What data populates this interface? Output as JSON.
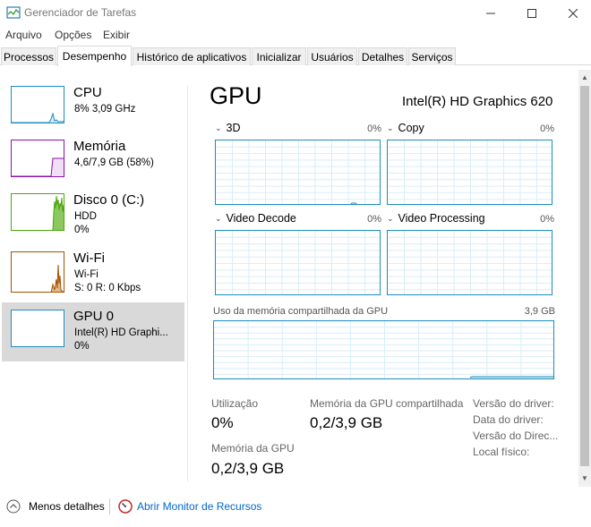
{
  "window": {
    "title": "Gerenciador de Tarefas"
  },
  "menu": [
    "Arquivo",
    "Opções",
    "Exibir"
  ],
  "tabs": [
    "Processos",
    "Desempenho",
    "Histórico de aplicativos",
    "Inicializar",
    "Usuários",
    "Detalhes",
    "Serviços"
  ],
  "active_tab": "Desempenho",
  "sidebar": [
    {
      "name": "CPU",
      "line1": "8%  3,09 GHz",
      "line2": "",
      "color": "#1a8ebd"
    },
    {
      "name": "Memória",
      "line1": "4,6/7,9 GB (58%)",
      "line2": "",
      "color": "#8b12ae"
    },
    {
      "name": "Disco 0 (C:)",
      "line1": "HDD",
      "line2": "0%",
      "color": "#4da60c"
    },
    {
      "name": "Wi-Fi",
      "line1": "Wi-Fi",
      "line2": "S: 0  R: 0 Kbps",
      "color": "#a74f01"
    },
    {
      "name": "GPU 0",
      "line1": "Intel(R) HD Graphi...",
      "line2": "0%",
      "color": "#1a8ebd",
      "selected": true
    }
  ],
  "main": {
    "title": "GPU",
    "model": "Intel(R) HD Graphics 620",
    "engines": [
      {
        "label": "3D",
        "pct": "0%"
      },
      {
        "label": "Copy",
        "pct": "0%"
      },
      {
        "label": "Video Decode",
        "pct": "0%"
      },
      {
        "label": "Video Processing",
        "pct": "0%"
      }
    ],
    "shared_memory": {
      "label": "Uso da memória compartilhada da GPU",
      "max": "3,9 GB"
    },
    "stats": {
      "utilization_label": "Utilização",
      "utilization_value": "0%",
      "gpu_memory_label": "Memória da GPU",
      "gpu_memory_value": "0,2/3,9 GB",
      "shared_label": "Memória da GPU compartilhada",
      "shared_value": "0,2/3,9 GB"
    },
    "info": [
      "Versão do driver:",
      "Data do driver:",
      "Versão do Direc...",
      "Local físico:"
    ]
  },
  "footer": {
    "fewer_details": "Menos detalhes",
    "open_monitor": "Abrir Monitor de Recursos"
  }
}
